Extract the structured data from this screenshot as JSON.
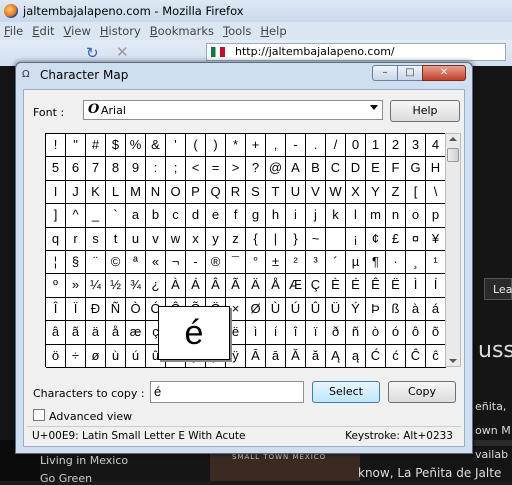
{
  "browser": {
    "window_title": "jaltembajalapeno.com - Mozilla Firefox",
    "menu": [
      "File",
      "Edit",
      "View",
      "History",
      "Bookmarks",
      "Tools",
      "Help"
    ],
    "url": "http://jaltembajalapeno.com/"
  },
  "webpage": {
    "sidebar_links": [
      "Living in Mexico",
      "Go Green"
    ],
    "tab_label": "Lea",
    "heading_fragment": "uss",
    "text_lines": [
      "eñita,",
      "own M",
      "vailab"
    ],
    "bottom_text": "know, La Peñita de Jalte",
    "book_title": "SMALL TOWN MEXICO"
  },
  "charmap": {
    "title": "Character Map",
    "font_label": "Font :",
    "font_value": "Arial",
    "help_label": "Help",
    "characters": [
      "!",
      "\"",
      "#",
      "$",
      "%",
      "&",
      "'",
      "(",
      ")",
      "*",
      "+",
      ",",
      "-",
      ".",
      "/",
      "0",
      "1",
      "2",
      "3",
      "4",
      "5",
      "6",
      "7",
      "8",
      "9",
      ":",
      ";",
      "<",
      "=",
      ">",
      "?",
      "@",
      "A",
      "B",
      "C",
      "D",
      "E",
      "F",
      "G",
      "H",
      "I",
      "J",
      "K",
      "L",
      "M",
      "N",
      "O",
      "P",
      "Q",
      "R",
      "S",
      "T",
      "U",
      "V",
      "W",
      "X",
      "Y",
      "Z",
      "[",
      "\\",
      "]",
      "^",
      "_",
      "`",
      "a",
      "b",
      "c",
      "d",
      "e",
      "f",
      "g",
      "h",
      "i",
      "j",
      "k",
      "l",
      "m",
      "n",
      "o",
      "p",
      "q",
      "r",
      "s",
      "t",
      "u",
      "v",
      "w",
      "x",
      "y",
      "z",
      "{",
      "|",
      "}",
      "~",
      "",
      "¡",
      "¢",
      "£",
      "¤",
      "¥",
      "¦",
      "§",
      "¨",
      "©",
      "ª",
      "«",
      "¬",
      "-",
      "®",
      "¯",
      "°",
      "±",
      "²",
      "³",
      "´",
      "µ",
      "¶",
      "·",
      "¸",
      "¹",
      "º",
      "»",
      "¼",
      "½",
      "¾",
      "¿",
      "À",
      "Á",
      "Â",
      "Ã",
      "Ä",
      "Å",
      "Æ",
      "Ç",
      "È",
      "É",
      "Ê",
      "Ë",
      "Ì",
      "Í",
      "Î",
      "Ï",
      "Ð",
      "Ñ",
      "Ò",
      "Ó",
      "Ô",
      "Õ",
      "Ö",
      "×",
      "Ø",
      "Ù",
      "Ú",
      "Û",
      "Ü",
      "Ý",
      "Þ",
      "ß",
      "à",
      "á",
      "â",
      "ã",
      "ä",
      "å",
      "æ",
      "ç",
      "è",
      "é",
      "ê",
      "ë",
      "ì",
      "í",
      "î",
      "ï",
      "ð",
      "ñ",
      "ò",
      "ó",
      "ô",
      "õ",
      "ö",
      "÷",
      "ø",
      "ù",
      "ú",
      "û",
      "ü",
      "ý",
      "þ",
      "ÿ",
      "Ā",
      "ā",
      "Ă",
      "ă",
      "Ą",
      "ą",
      "Ć",
      "ć",
      "Ĉ",
      "ĉ"
    ],
    "zoom_char": "é",
    "characters_to_copy_label": "Characters to copy :",
    "characters_to_copy_value": "é",
    "select_label": "Select",
    "copy_label": "Copy",
    "advanced_view_label": "Advanced view",
    "advanced_view_checked": false,
    "status_left": "U+00E9: Latin Small Letter E With Acute",
    "status_right": "Keystroke: Alt+0233"
  }
}
